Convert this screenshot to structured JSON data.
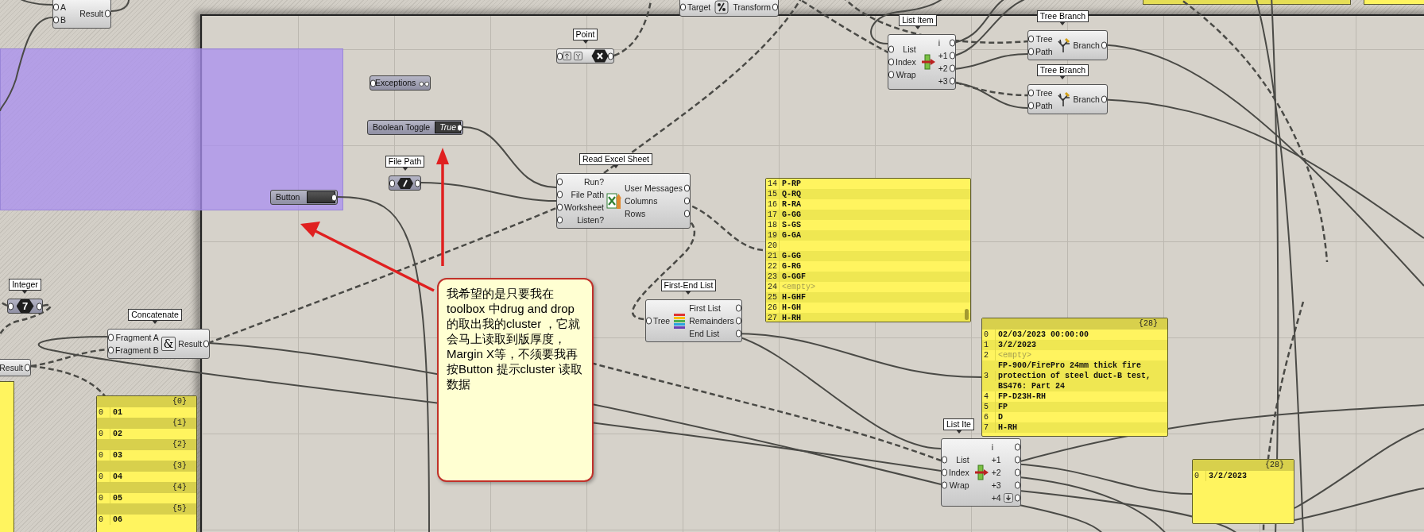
{
  "canvas": {
    "nodes": [
      {
        "kind": "component",
        "inputs": [
          "A",
          "B"
        ],
        "outputs": [
          "Result"
        ]
      },
      {
        "kind": "component",
        "inputs": [
          "Target"
        ],
        "outputs": [
          "Transform"
        ]
      },
      {
        "kind": "point",
        "label": "Point"
      },
      {
        "kind": "param",
        "title": "Exceptions"
      },
      {
        "kind": "toggle",
        "title": "Boolean Toggle",
        "value": "True"
      },
      {
        "kind": "filepath",
        "label": "File Path"
      },
      {
        "kind": "button",
        "title": "Button"
      },
      {
        "kind": "component",
        "label": "Read Excel Sheet",
        "inputs": [
          "Run?",
          "File Path",
          "Worksheet",
          "Listen?"
        ],
        "outputs": [
          "User Messages",
          "Columns",
          "Rows"
        ]
      },
      {
        "kind": "component",
        "label": "List Item",
        "inputs": [
          "List",
          "Index",
          "Wrap"
        ],
        "outputs": [
          "i",
          "+1",
          "+2",
          "+3"
        ]
      },
      {
        "kind": "component",
        "label": "Tree Branch",
        "inputs": [
          "Tree",
          "Path"
        ],
        "outputs": [
          "Branch"
        ]
      },
      {
        "kind": "component",
        "label": "Tree Branch",
        "inputs": [
          "Tree",
          "Path"
        ],
        "outputs": [
          "Branch"
        ]
      },
      {
        "kind": "panel",
        "branches": [
          {
            "rows": [
              {
                "index": "14",
                "text": "P-RP",
                "kind": "value"
              },
              {
                "index": "15",
                "text": "Q-RQ",
                "kind": "value"
              },
              {
                "index": "16",
                "text": "R-RA",
                "kind": "value"
              },
              {
                "index": "17",
                "text": "G-GG",
                "kind": "value"
              },
              {
                "index": "18",
                "text": "S-GS",
                "kind": "value"
              },
              {
                "index": "19",
                "text": "G-GA",
                "kind": "value"
              },
              {
                "index": "20"
              },
              {
                "index": "21",
                "text": "G-GG",
                "kind": "value"
              },
              {
                "index": "22",
                "text": "G-RG",
                "kind": "value"
              },
              {
                "index": "23",
                "text": "G-GGF",
                "kind": "value"
              },
              {
                "index": "24",
                "text": "<empty>",
                "kind": "empty"
              },
              {
                "index": "25",
                "text": "H-GHF",
                "kind": "value"
              },
              {
                "index": "26",
                "text": "H-GH",
                "kind": "value"
              },
              {
                "index": "27",
                "text": "H-RH",
                "kind": "value"
              }
            ]
          }
        ]
      },
      {
        "kind": "integer",
        "label": "Integer",
        "value": "7"
      },
      {
        "kind": "component",
        "label": "Concatenate",
        "symbol": "&",
        "inputs": [
          "Fragment A",
          "Fragment B"
        ],
        "outputs": [
          "Result"
        ]
      },
      {
        "kind": "component",
        "label": "First-End List",
        "inputs": [
          "Tree"
        ],
        "outputs": [
          "First List",
          "Remainders",
          "End List"
        ]
      },
      {
        "kind": "panel",
        "branches": [
          {
            "path": "{28}",
            "rows": [
              {
                "index": "0",
                "text": "02/03/2023 00:00:00",
                "kind": "value"
              },
              {
                "index": "1",
                "text": "3/2/2023",
                "kind": "value"
              },
              {
                "index": "2",
                "text": "<empty>",
                "kind": "empty"
              },
              {
                "index": "3",
                "text": "FP-900/FirePro 24mm thick fire protection of steel duct-B test, BS476: Part 24",
                "kind": "value"
              },
              {
                "index": "4",
                "text": "FP-D23H-RH",
                "kind": "value"
              },
              {
                "index": "5",
                "text": "FP",
                "kind": "value"
              },
              {
                "index": "6",
                "text": "D",
                "kind": "value"
              },
              {
                "index": "7",
                "text": "H-RH",
                "kind": "value"
              }
            ]
          }
        ]
      },
      {
        "kind": "component",
        "outputs": [
          "Result"
        ]
      },
      {
        "kind": "panel",
        "branches": [
          {
            "path": "{0}",
            "rows": [
              {
                "index": "0",
                "text": "01",
                "kind": "value"
              }
            ]
          },
          {
            "path": "{1}",
            "rows": [
              {
                "index": "0",
                "text": "02",
                "kind": "value"
              }
            ]
          },
          {
            "path": "{2}",
            "rows": [
              {
                "index": "0",
                "text": "03",
                "kind": "value"
              }
            ]
          },
          {
            "path": "{3}",
            "rows": [
              {
                "index": "0",
                "text": "04",
                "kind": "value"
              }
            ]
          },
          {
            "path": "{4}",
            "rows": [
              {
                "index": "0",
                "text": "05",
                "kind": "value"
              }
            ]
          },
          {
            "path": "{5}",
            "rows": [
              {
                "index": "0",
                "text": "06",
                "kind": "value"
              }
            ]
          }
        ]
      },
      {
        "kind": "component",
        "label": "List Ite",
        "inputs": [
          "List",
          "Index",
          "Wrap"
        ],
        "outputs": [
          "i",
          "+1",
          "+2",
          "+3",
          "+4"
        ]
      },
      {
        "kind": "panel",
        "branches": [
          {
            "path": "{28}",
            "rows": [
              {
                "index": "0",
                "text": "3/2/2023",
                "kind": "value"
              }
            ]
          }
        ]
      }
    ],
    "note": {
      "text": "我希望的是只要我在toolbox 中drug and drop 的取出我的cluster ，它就会马上读取到版厚度，Margin X等，不须要我再按Button 提示cluster 读取数据"
    }
  }
}
